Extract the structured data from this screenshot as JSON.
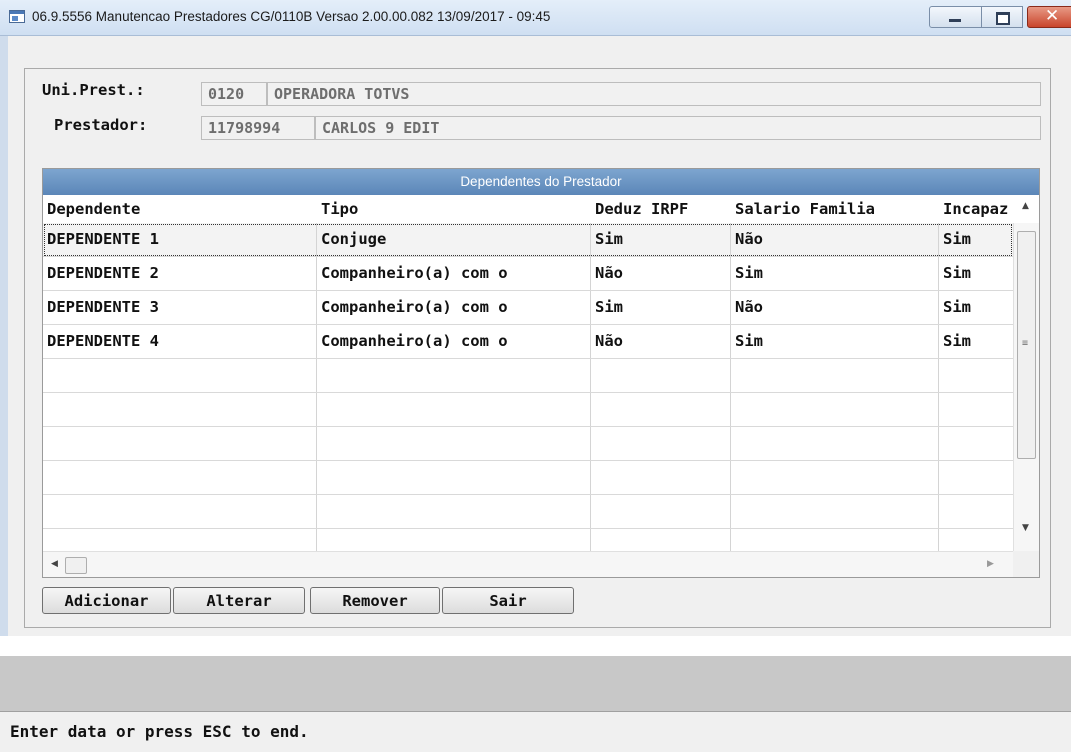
{
  "window": {
    "title": "06.9.5556 Manutencao  Prestadores CG/0110B Versao 2.00.00.082 13/09/2017 - 09:45"
  },
  "form": {
    "uni_prest_label": "Uni.Prest.:",
    "uni_prest_code": "0120",
    "uni_prest_name": "OPERADORA TOTVS",
    "prestador_label": "Prestador:",
    "prestador_code": "11798994",
    "prestador_name": "CARLOS 9 EDIT"
  },
  "grid": {
    "caption": "Dependentes do Prestador",
    "columns": [
      "Dependente",
      "Tipo",
      "Deduz IRPF",
      "Salario Familia",
      "Incapaz"
    ],
    "rows": [
      [
        "DEPENDENTE 1",
        "Conjuge",
        "Sim",
        "Não",
        "Sim"
      ],
      [
        "DEPENDENTE 2",
        "Companheiro(a) com o",
        "Não",
        "Sim",
        "Sim"
      ],
      [
        "DEPENDENTE 3",
        "Companheiro(a) com o",
        "Sim",
        "Não",
        "Sim"
      ],
      [
        "DEPENDENTE 4",
        "Companheiro(a) com o",
        "Não",
        "Sim",
        "Sim"
      ]
    ]
  },
  "buttons": {
    "add": "Adicionar",
    "edit": "Alterar",
    "remove": "Remover",
    "exit": "Sair"
  },
  "status": {
    "message": "Enter data or press ESC to end."
  }
}
